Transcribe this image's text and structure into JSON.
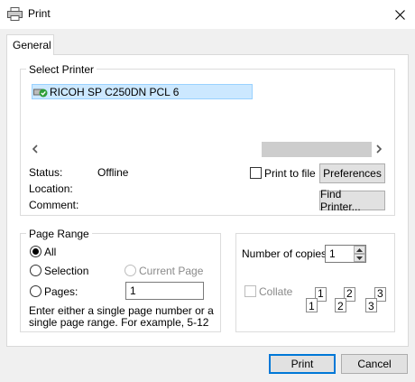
{
  "window": {
    "title": "Print",
    "close_icon": "close-icon",
    "printer_icon": "printer-icon"
  },
  "tabs": [
    {
      "label": "General"
    }
  ],
  "select_printer": {
    "label": "Select Printer",
    "printers": [
      {
        "name": "RICOH SP C250DN PCL 6",
        "icon": "printer-default-icon"
      }
    ],
    "status_label": "Status:",
    "status_value": "Offline",
    "location_label": "Location:",
    "comment_label": "Comment:",
    "print_to_file_label": "Print to file",
    "preferences_label": "Preferences",
    "find_printer_label": "Find Printer..."
  },
  "page_range": {
    "label": "Page Range",
    "all_label": "All",
    "selection_label": "Selection",
    "current_page_label": "Current Page",
    "pages_label": "Pages:",
    "pages_value": "1",
    "hint": "Enter either a single page number or a single page range.  For example, 5-12"
  },
  "copies": {
    "number_label": "Number of copies:",
    "number_value": "1",
    "collate_label": "Collate",
    "collate_pages": [
      [
        "1",
        "1"
      ],
      [
        "2",
        "2"
      ],
      [
        "3",
        "3"
      ]
    ]
  },
  "footer": {
    "print_label": "Print",
    "cancel_label": "Cancel"
  }
}
